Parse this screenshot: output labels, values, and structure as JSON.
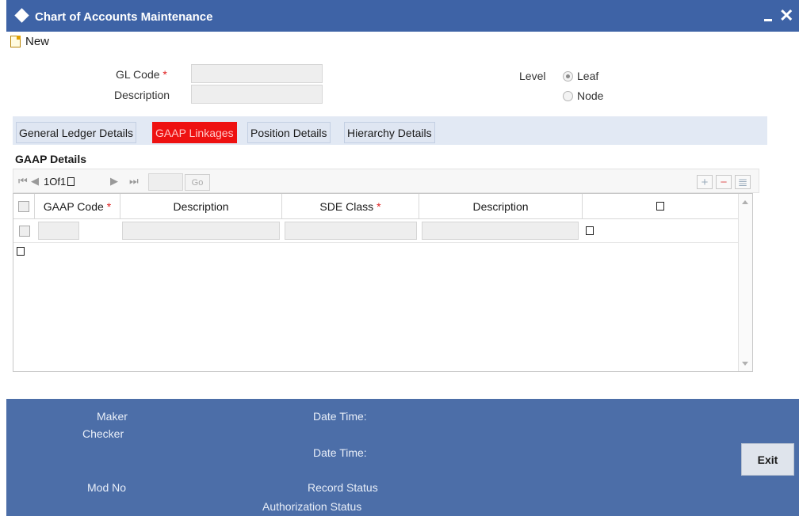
{
  "window": {
    "title": "Chart of Accounts Maintenance",
    "minimize_icon": "minimize-icon",
    "close_symbol": "✕"
  },
  "toolbar": {
    "new_label": "New"
  },
  "form": {
    "gl_code_label": "GL Code",
    "required_mark": "*",
    "description_label": "Description",
    "gl_code_value": "",
    "description_value": "",
    "level_label": "Level",
    "level_options": [
      "Leaf",
      "Node"
    ],
    "level_selected": "Leaf"
  },
  "tabs": [
    {
      "label": "General Ledger Details",
      "active": false
    },
    {
      "label": "GAAP Linkages",
      "active": true
    },
    {
      "label": "Position Details",
      "active": false
    },
    {
      "label": "Hierarchy Details",
      "active": false
    }
  ],
  "section": {
    "title": "GAAP Details"
  },
  "pagination": {
    "text": "1Of1",
    "page_input": "",
    "go_label": "Go"
  },
  "grid": {
    "columns": [
      {
        "label": "GAAP Code",
        "required": true
      },
      {
        "label": "Description",
        "required": false
      },
      {
        "label": "SDE Class",
        "required": true
      },
      {
        "label": "Description",
        "required": false
      }
    ],
    "rows": [
      {
        "gaap_code": "",
        "description": "",
        "sde_class": "",
        "sde_description": ""
      }
    ]
  },
  "footer": {
    "maker": "Maker",
    "checker": "Checker",
    "date_time_1": "Date Time:",
    "date_time_2": "Date Time:",
    "mod_no": "Mod No",
    "record_status": "Record Status",
    "authorization_status": "Authorization Status",
    "exit_label": "Exit"
  },
  "colors": {
    "title_bar": "#3e63a6",
    "active_tab": "#ee1111",
    "footer": "#4c6ea8"
  }
}
